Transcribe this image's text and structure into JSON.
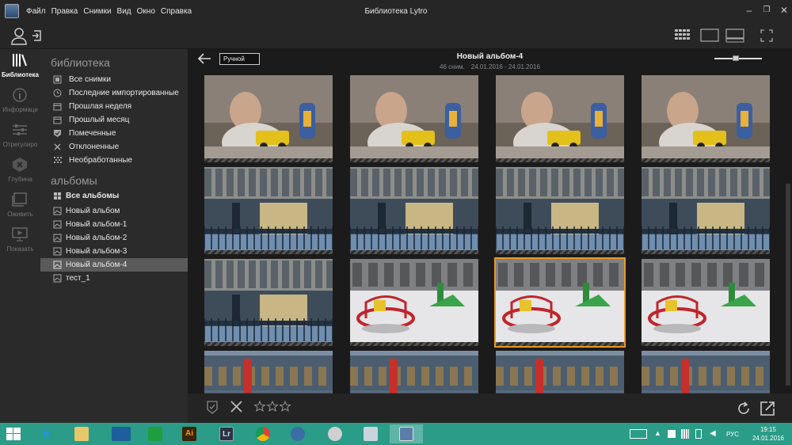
{
  "menu": [
    "Файл",
    "Правка",
    "Снимки",
    "Вид",
    "Окно",
    "Справка"
  ],
  "window_title": "Библиотека Lytro",
  "rail": [
    {
      "label": "Библиотека",
      "icon": "library-icon",
      "active": true
    },
    {
      "label": "Информаци",
      "icon": "info-icon",
      "active": false
    },
    {
      "label": "Отрегулиро",
      "icon": "adjust-icon",
      "active": false
    },
    {
      "label": "Глубина",
      "icon": "depth-icon",
      "active": false
    },
    {
      "label": "Оживить",
      "icon": "animate-icon",
      "active": false
    },
    {
      "label": "Показать",
      "icon": "present-icon",
      "active": false
    }
  ],
  "sidebar": {
    "library_heading": "библиотека",
    "library_items": [
      {
        "label": "Все снимки",
        "icon": "all-photos-icon"
      },
      {
        "label": "Последние импортированные",
        "icon": "clock-icon"
      },
      {
        "label": "Прошлая неделя",
        "icon": "calendar-icon"
      },
      {
        "label": "Прошлый месяц",
        "icon": "calendar-icon"
      },
      {
        "label": "Помеченные",
        "icon": "flag-icon"
      },
      {
        "label": "Отклоненные",
        "icon": "reject-icon"
      },
      {
        "label": "Необработанные",
        "icon": "unprocessed-icon"
      }
    ],
    "albums_heading": "альбомы",
    "album_items": [
      {
        "label": "Все альбомы",
        "icon": "all-albums-icon",
        "bold": true
      },
      {
        "label": "Новый альбом",
        "icon": "album-icon"
      },
      {
        "label": "Новый альбом-1",
        "icon": "album-icon"
      },
      {
        "label": "Новый альбом-2",
        "icon": "album-icon"
      },
      {
        "label": "Новый альбом-3",
        "icon": "album-icon"
      },
      {
        "label": "Новый альбом-4",
        "icon": "album-icon",
        "selected": true
      },
      {
        "label": "тест_1",
        "icon": "album-icon"
      }
    ]
  },
  "main": {
    "sort_label": "Ручной",
    "album_title": "Новый альбом-4",
    "photo_count": "46 сним.",
    "date_range": "24.01.2016 - 24.01.2016",
    "zoom_level": 0.45,
    "selected_photo": 10,
    "photos": [
      "baby",
      "baby",
      "baby",
      "baby",
      "building",
      "building",
      "building",
      "building",
      "building",
      "playground",
      "playground",
      "playground",
      "park",
      "park",
      "park",
      "park"
    ]
  },
  "taskbar": {
    "apps": [
      "windows-start",
      "internet-explorer",
      "file-explorer",
      "lenovo",
      "store",
      "illustrator",
      "lightroom",
      "chrome",
      "thunderbird",
      "audio-app",
      "files-app",
      "lytro"
    ],
    "language": "РУС",
    "time": "19:15",
    "date": "24.01.2016"
  },
  "colors": {
    "accent_selection": "#e89a24",
    "taskbar": "#2a9c87"
  }
}
